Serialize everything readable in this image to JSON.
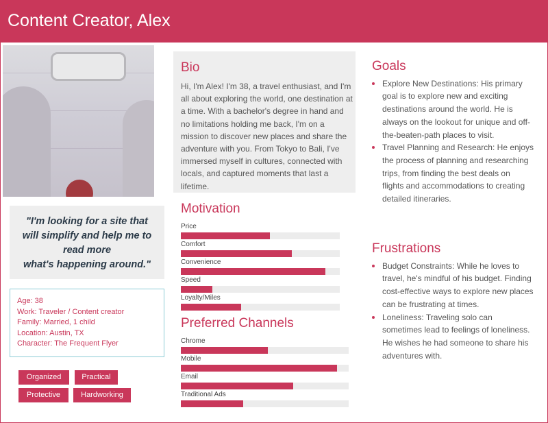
{
  "header": {
    "title": "Content Creator, Alex"
  },
  "quote": {
    "lines": [
      "\"I'm looking for a site that",
      "will simplify and help me to",
      "read more",
      "what's happening around.\""
    ]
  },
  "info": {
    "age": "Age: 38",
    "work": "Work: Traveler / Content creator",
    "family": "Family: Married, 1 child",
    "location": "Location: Austin, TX",
    "character": "Character: The Frequent Flyer"
  },
  "tags": [
    "Organized",
    "Practical",
    "Protective",
    "Hardworking"
  ],
  "bio": {
    "title": "Bio",
    "text": "Hi, I'm Alex! I'm 38, a travel enthusiast, and I'm all about exploring the world, one destination at a time. With a bachelor's degree in hand and no limitations holding me back, I'm on a mission to discover new places and share the adventure with you. From Tokyo to Bali, I've immersed myself in cultures, connected with locals, and captured moments that last a lifetime."
  },
  "motivation": {
    "title": "Motivation",
    "items": [
      {
        "label": "Price",
        "value": 0.56
      },
      {
        "label": "Comfort",
        "value": 0.7
      },
      {
        "label": "Convenience",
        "value": 0.91
      },
      {
        "label": "Speed",
        "value": 0.2
      },
      {
        "label": "Loyalty/Miles",
        "value": 0.38
      }
    ]
  },
  "channels": {
    "title": "Preferred Channels",
    "items": [
      {
        "label": "Chrome",
        "value": 0.52
      },
      {
        "label": "Mobile",
        "value": 0.93
      },
      {
        "label": "Email",
        "value": 0.67
      },
      {
        "label": "Traditional Ads",
        "value": 0.37
      }
    ]
  },
  "goals": {
    "title": "Goals",
    "items": [
      "Explore New Destinations: His primary goal is to explore new and exciting destinations around the world. He is always on the lookout for unique and off-the-beaten-path places to visit.",
      "Travel Planning and Research: He enjoys the process of planning and researching trips, from finding the best deals on flights and accommodations to creating detailed itineraries."
    ]
  },
  "frustrations": {
    "title": "Frustrations",
    "items": [
      "Budget Constraints: While he loves to travel, he's mindful of his budget. Finding cost-effective ways to explore new places can be frustrating at times.",
      "Loneliness: Traveling solo can sometimes lead to feelings of loneliness. He wishes he had someone to share his adventures with."
    ]
  },
  "colors": {
    "accent": "#c9375a",
    "panel": "#eeeeee",
    "info_border": "#8ccbd6"
  }
}
